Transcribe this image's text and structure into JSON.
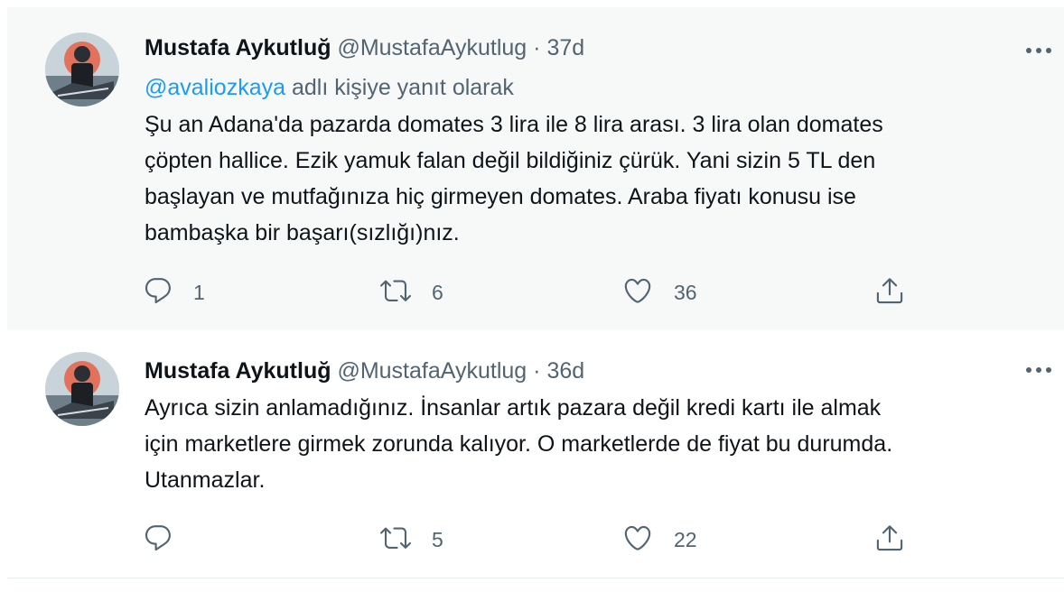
{
  "tweets": [
    {
      "author_name": "Mustafa Aykutluğ",
      "handle": "@MustafaAykutlug",
      "separator": "·",
      "time": "37d",
      "reply_prefix": "@avaliozkaya",
      "reply_suffix": " adlı kişiye yanıt olarak",
      "text": "Şu an Adana'da pazarda domates 3 lira ile 8 lira arası. 3 lira olan domates\nçöpten hallice. Ezik yamuk falan değil bildiğiniz çürük. Yani sizin 5 TL den\nbaşlayan ve mutfağınıza hiç girmeyen domates. Araba fiyatı konusu ise\nbambaşka bir başarı(sızlığı)nız.",
      "counts": {
        "replies": "1",
        "retweets": "6",
        "likes": "36"
      }
    },
    {
      "author_name": "Mustafa Aykutluğ",
      "handle": "@MustafaAykutlug",
      "separator": "·",
      "time": "36d",
      "text": "Ayrıca sizin anlamadığınız. İnsanlar artık pazara değil kredi kartı ile almak\niçin marketlere girmek zorunda kalıyor. O marketlerde de fiyat bu durumda.\nUtanmazlar.",
      "counts": {
        "replies": "",
        "retweets": "5",
        "likes": "22"
      }
    }
  ],
  "icons": {
    "reply": "reply-icon",
    "retweet": "retweet-icon",
    "like": "heart-icon",
    "share": "share-icon",
    "more": "more-icon"
  },
  "colors": {
    "text": "#0f1419",
    "secondary": "#536471",
    "link": "#1d9bf0",
    "highlight_bg": "#f7f9f9",
    "thread_line": "#cfd9de"
  }
}
